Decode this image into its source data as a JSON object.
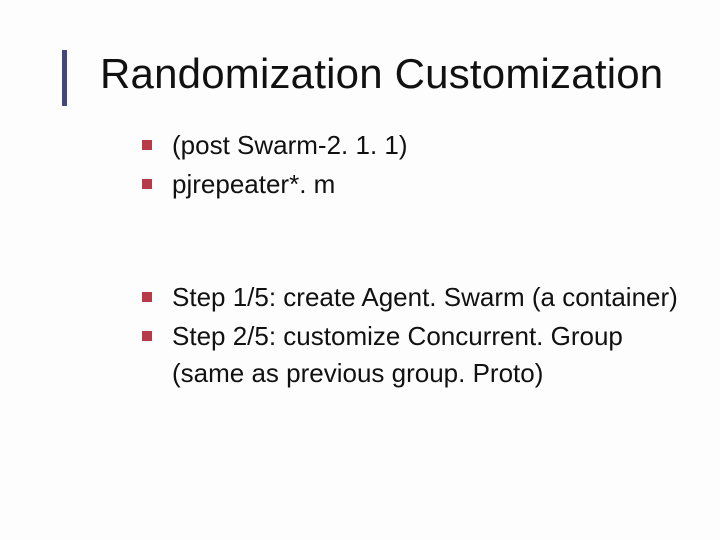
{
  "title": "Randomization Customization",
  "block1": {
    "items": [
      "(post Swarm-2. 1. 1)",
      "pjrepeater*. m"
    ]
  },
  "block2": {
    "items": [
      "Step 1/5: create Agent. Swarm (a container)",
      "Step 2/5: customize Concurrent. Group"
    ],
    "continuation": "(same as previous  group. Proto)"
  }
}
